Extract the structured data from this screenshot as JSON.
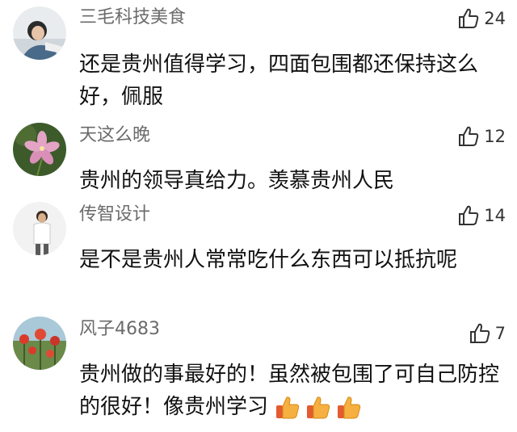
{
  "comments": [
    {
      "user": "三毛科技美食",
      "likes": "24",
      "text": "还是贵州值得学习，四面包围都还保持这么好，佩服",
      "avatar_icon": "person-avatar"
    },
    {
      "user": "天这么晚",
      "likes": "12",
      "text": "贵州的领导真给力。羡慕贵州人民",
      "avatar_icon": "pink-flower-avatar"
    },
    {
      "user": "传智设计",
      "likes": "14",
      "text": "是不是贵州人常常吃什么东西可以抵抗呢",
      "avatar_icon": "man-standing-avatar"
    },
    {
      "user": "风子4683",
      "likes": "7",
      "text": "贵州做的事最好的！虽然被包围了可自己防控的很好！像贵州学习",
      "avatar_icon": "red-flowers-avatar",
      "trailing_emoji": [
        "thumbs-up-emoji",
        "thumbs-up-emoji",
        "thumbs-up-emoji"
      ]
    }
  ],
  "colors": {
    "username": "#6b6b6b",
    "text": "#111111",
    "like_icon": "#333333",
    "emoji": "#f5a623"
  }
}
